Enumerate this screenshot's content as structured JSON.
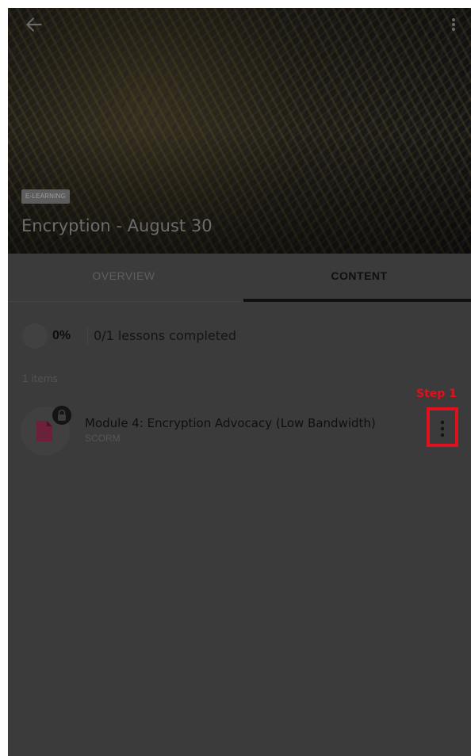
{
  "header": {
    "back_icon": "arrow-left-icon",
    "more_icon": "more-vertical-icon",
    "badge": "E-LEARNING",
    "title": "Encryption - August 30"
  },
  "tabs": [
    {
      "label": "OVERVIEW",
      "active": false
    },
    {
      "label": "CONTENT",
      "active": true
    }
  ],
  "progress": {
    "percent_label": "0%",
    "percent_value": 0,
    "summary": "0/1 lessons completed"
  },
  "content": {
    "items_count_label": "1 items",
    "items": [
      {
        "title": "Module 4: Encryption Advocacy (Low Bandwidth)",
        "type": "SCORM",
        "icon": "file-icon",
        "locked": true,
        "lock_icon": "lock-icon",
        "menu_icon": "more-vertical-icon"
      }
    ]
  },
  "annotation": {
    "step_label": "Step 1",
    "color": "#e0101d"
  },
  "colors": {
    "overlay_background": "#3b3b3b",
    "accent_highlight": "#e0101d",
    "file_icon": "#6e1f3a"
  }
}
